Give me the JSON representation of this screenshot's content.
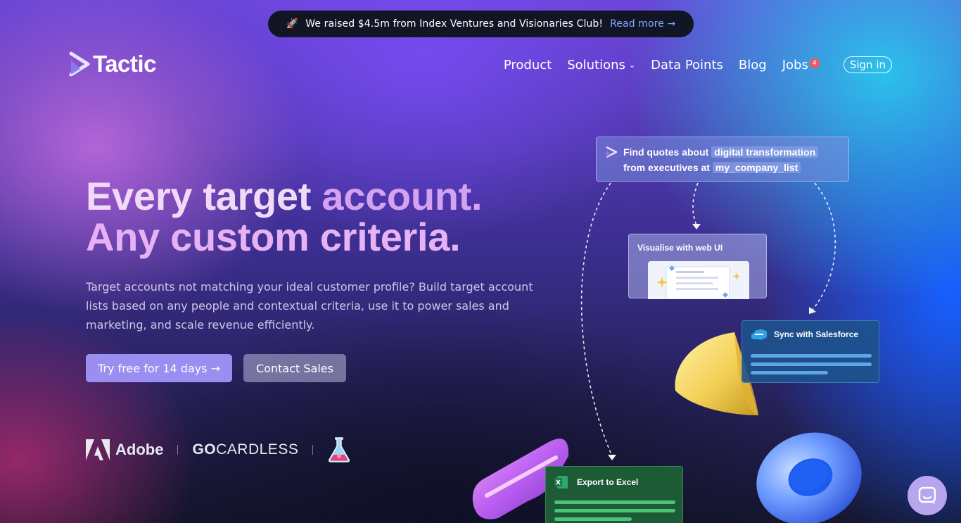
{
  "announcement": {
    "icon": "rocket-icon",
    "text": "We raised $4.5m from Index Ventures and Visionaries Club!",
    "link": "Read more →"
  },
  "header": {
    "brand": "Tactic",
    "nav": [
      {
        "label": "Product"
      },
      {
        "label": "Solutions"
      },
      {
        "label": "Data Points"
      },
      {
        "label": "Blog"
      },
      {
        "label": "Jobs",
        "badge": "4"
      }
    ],
    "signin": "Sign in"
  },
  "hero": {
    "headline_part1": "Every target ",
    "headline_part2": "account.",
    "headline_line2": "Any custom criteria.",
    "description": "Target accounts not matching your ideal customer profile? Build target account lists based on any people and contextual criteria, use it to power sales and marketing, and scale revenue efficiently.",
    "primary_cta": "Try free for 14 days →",
    "secondary_cta": "Contact Sales"
  },
  "customers": {
    "adobe": "Adobe",
    "gocardless_bold": "GO",
    "gocardless_light": "CARDLESS",
    "third_logo_icon": "flask-logo-icon"
  },
  "illustration": {
    "prompt_line1": "Find quotes about",
    "prompt_term1": "digital transformation",
    "prompt_line2": "from executives at",
    "prompt_term2": "my_company_list",
    "web_ui": "Visualise with web UI",
    "salesforce": "Sync with Salesforce",
    "excel": "Export to Excel"
  },
  "colors": {
    "primary_button": "#9a8ef0",
    "announcement_link": "#7fa9ff",
    "badge": "#f4575b"
  }
}
